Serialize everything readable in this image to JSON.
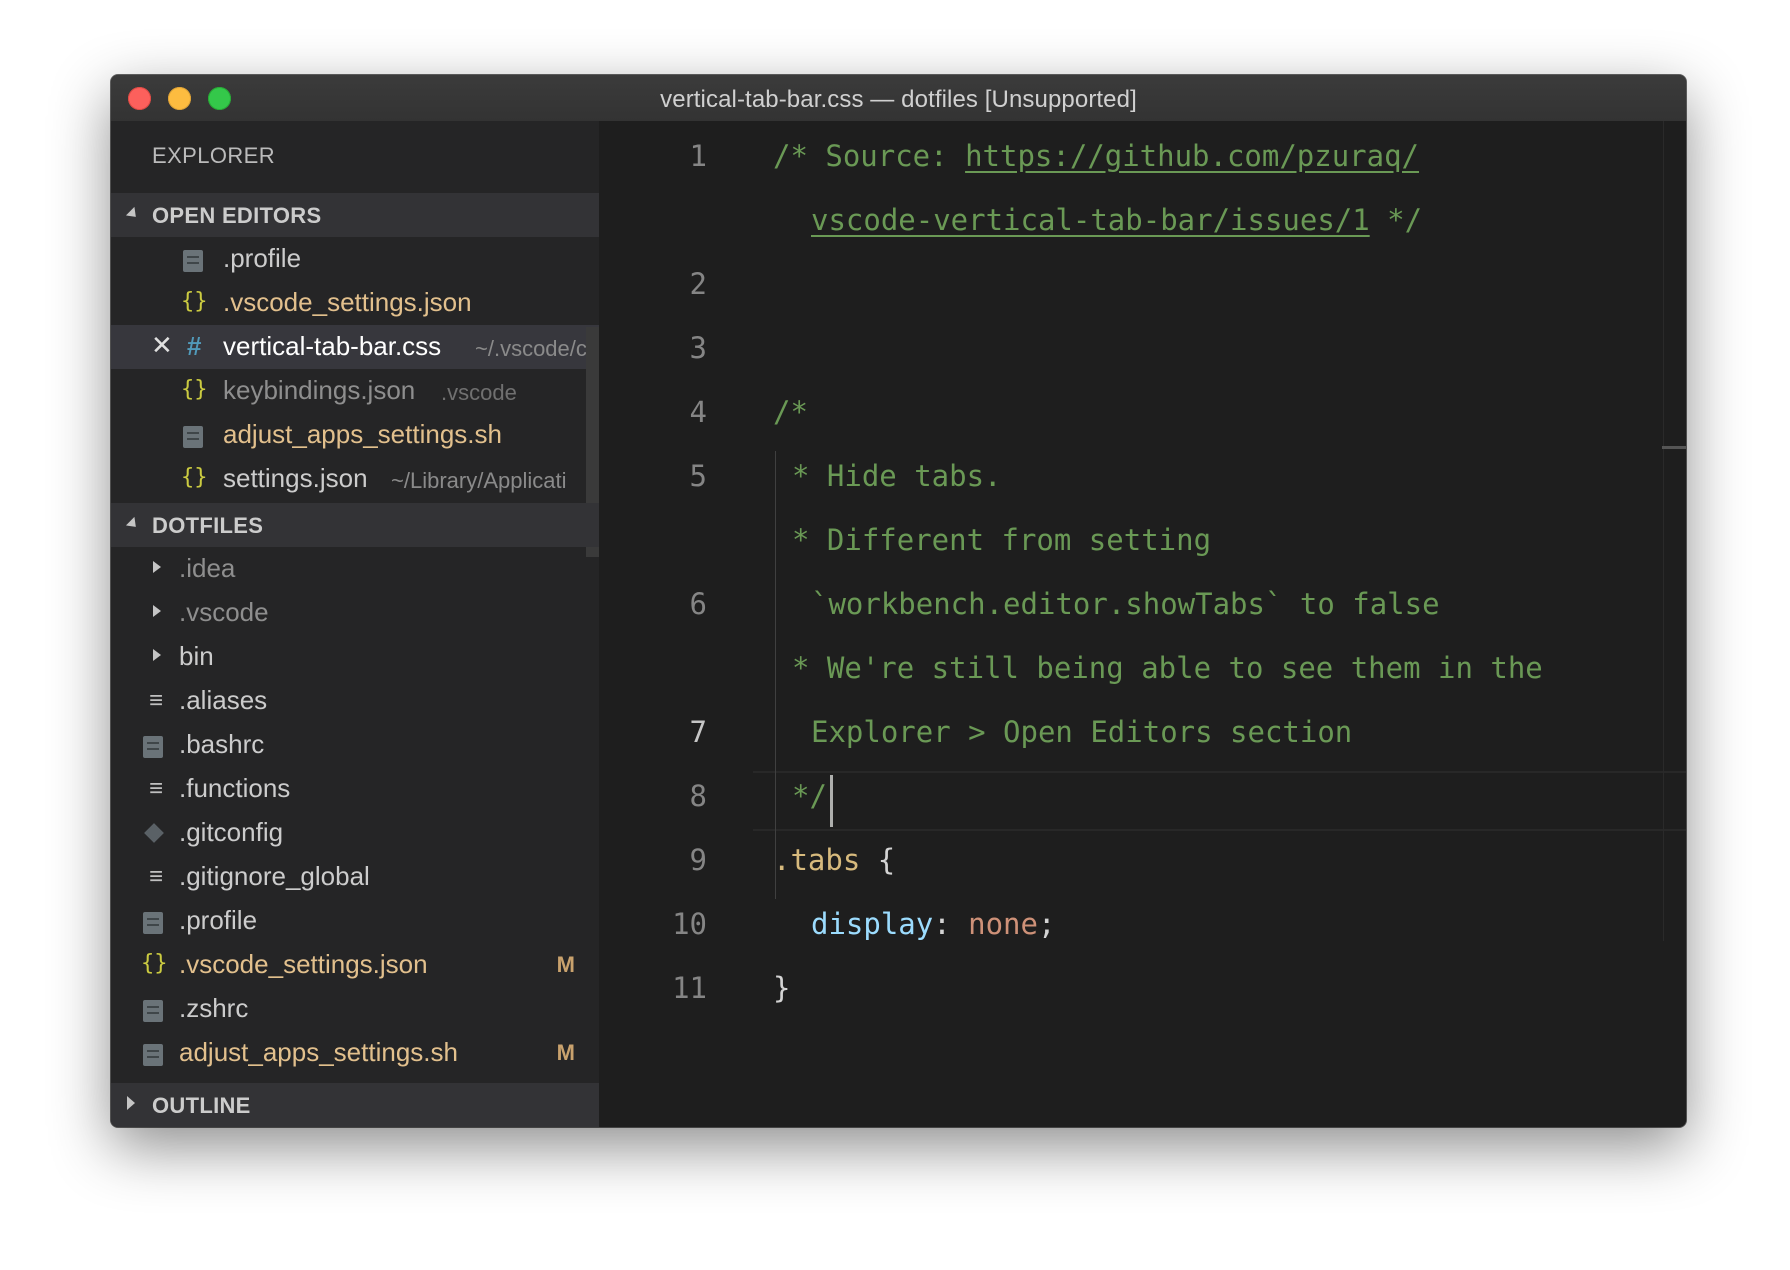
{
  "window": {
    "title": "vertical-tab-bar.css — dotfiles [Unsupported]"
  },
  "sidebar": {
    "title": "EXPLORER",
    "open_editors": {
      "header": "OPEN EDITORS",
      "items": [
        {
          "label": ".profile",
          "desc": "",
          "icon": "file-icon"
        },
        {
          "label": ".vscode_settings.json",
          "desc": "",
          "icon": "json-icon"
        },
        {
          "label": "vertical-tab-bar.css",
          "desc": "~/.vscode/c",
          "icon": "css-icon",
          "close": "✕"
        },
        {
          "label": "keybindings.json",
          "desc": ".vscode",
          "icon": "json-icon"
        },
        {
          "label": "adjust_apps_settings.sh",
          "desc": "",
          "icon": "file-icon"
        },
        {
          "label": "settings.json",
          "desc": "~/Library/Applicati",
          "icon": "json-icon"
        }
      ]
    },
    "dotfiles": {
      "header": "DOTFILES",
      "items": [
        {
          "label": ".idea",
          "icon": "folder"
        },
        {
          "label": ".vscode",
          "icon": "folder"
        },
        {
          "label": "bin",
          "icon": "folder"
        },
        {
          "label": ".aliases",
          "icon": "lines-icon"
        },
        {
          "label": ".bashrc",
          "icon": "file-icon"
        },
        {
          "label": ".functions",
          "icon": "lines-icon"
        },
        {
          "label": ".gitconfig",
          "icon": "git-icon"
        },
        {
          "label": ".gitignore_global",
          "icon": "lines-icon"
        },
        {
          "label": ".profile",
          "icon": "file-icon"
        },
        {
          "label": ".vscode_settings.json",
          "icon": "json-icon",
          "badge": "M"
        },
        {
          "label": ".zshrc",
          "icon": "file-icon"
        },
        {
          "label": "adjust_apps_settings.sh",
          "icon": "file-icon",
          "badge": "M"
        }
      ]
    },
    "outline": {
      "header": "OUTLINE"
    }
  },
  "editor": {
    "line_numbers": [
      "1",
      "2",
      "3",
      "4",
      "5",
      "6",
      "7",
      "8",
      "9",
      "10",
      "11"
    ],
    "code": {
      "l1a_comment": "/* Source: ",
      "l1a_link": "https://github.com/pzuraq/",
      "l1b_link": "vscode-vertical-tab-bar/issues/1",
      "l1b_end": " */",
      "l3": "/*",
      "l4": "* Hide tabs.",
      "l5a": "* Different from setting",
      "l5b": "`workbench.editor.showTabs` to false",
      "l6a": "* We're still being able to see them in the",
      "l6b": "Explorer > Open Editors section",
      "l7": "*/",
      "l8_selector": ".tabs",
      "l8_brace": " {",
      "l9_prop": "display",
      "l9_colon": ": ",
      "l9_value": "none",
      "l9_semi": ";",
      "l10": "}"
    }
  },
  "colors": {
    "background": "#1e1e1e",
    "sidebar": "#252526",
    "comment": "#6a9955",
    "selector": "#d7ba7d",
    "property": "#9cdcfe",
    "value": "#ce9178",
    "modified": "#e2c08d"
  }
}
